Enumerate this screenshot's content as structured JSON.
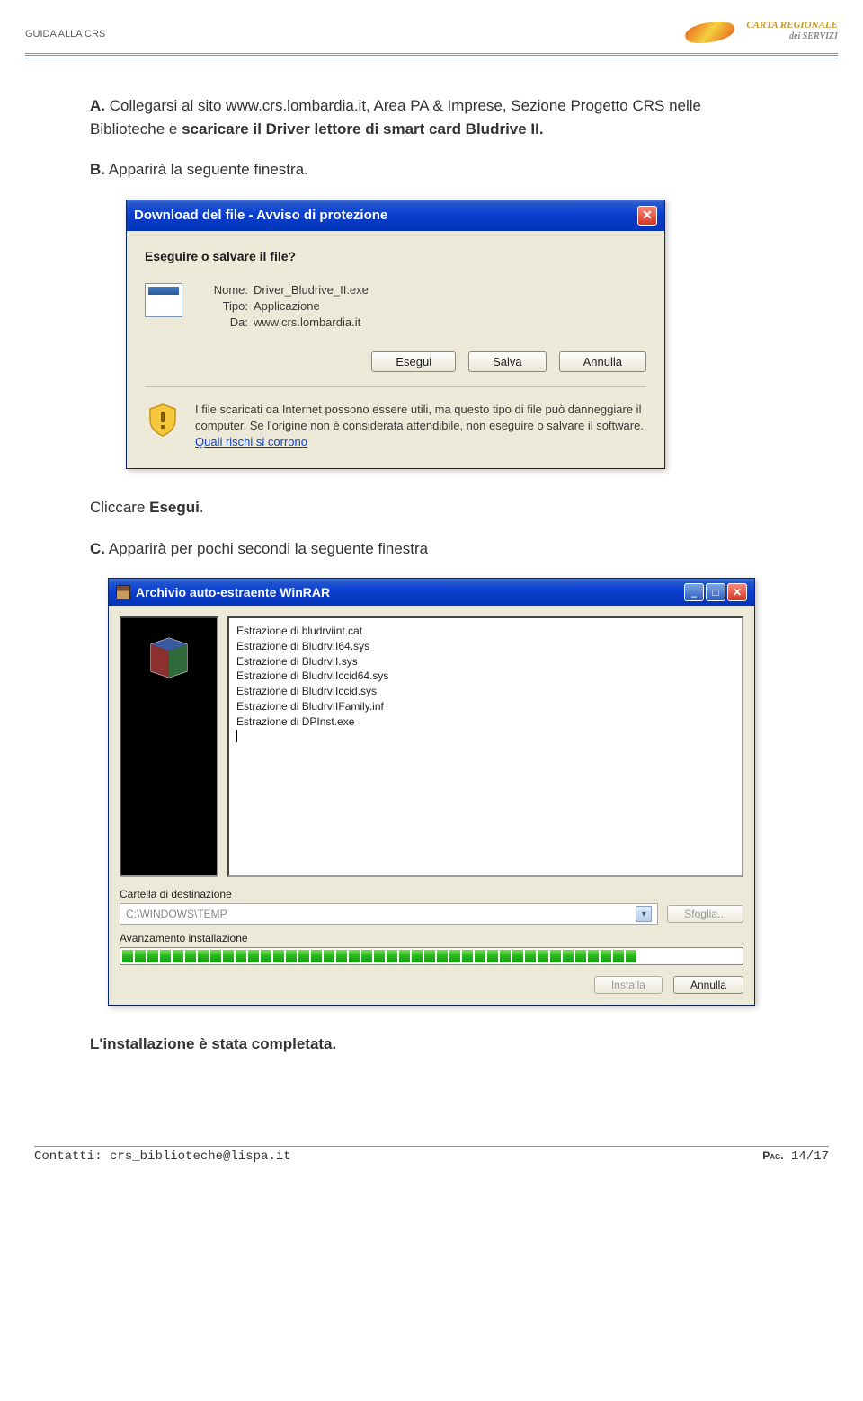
{
  "header": {
    "title": "GUIDA ALLA CRS",
    "logo_line1": "CARTA REGIONALE",
    "logo_line2": "dei SERVIZI"
  },
  "section_a": {
    "label": "A.",
    "text_pre": " Collegarsi al sito ",
    "url": "www.crs.lombardia.it",
    "text_mid": ", Area PA & Imprese, Sezione Progetto CRS nelle Biblioteche e ",
    "bold2": "scaricare il Driver lettore di smart card Bludrive II."
  },
  "section_b": {
    "label": "B.",
    "text": " Apparirà la seguente finestra."
  },
  "download_dialog": {
    "title": "Download del file - Avviso di protezione",
    "question": "Eseguire o salvare il file?",
    "rows": {
      "name_label": "Nome:",
      "name_value": "Driver_Bludrive_II.exe",
      "type_label": "Tipo:",
      "type_value": "Applicazione",
      "from_label": "Da:",
      "from_value": "www.crs.lombardia.it"
    },
    "buttons": {
      "run": "Esegui",
      "save": "Salva",
      "cancel": "Annulla"
    },
    "warning": "I file scaricati da Internet possono essere utili, ma questo tipo di file può danneggiare il computer. Se l'origine non è considerata attendibile, non eseguire o salvare il software. ",
    "warning_link": "Quali rischi si corrono"
  },
  "after_download": {
    "label": "Cliccare ",
    "bold": "Esegui",
    "dot": "."
  },
  "section_c": {
    "label": "C.",
    "text": " Apparirà per pochi secondi la seguente finestra"
  },
  "winrar": {
    "title": "Archivio auto-estraente WinRAR",
    "lines": [
      "Estrazione di bludrviint.cat",
      "Estrazione di BludrvII64.sys",
      "Estrazione di BludrvII.sys",
      "Estrazione di BludrvIIccid64.sys",
      "Estrazione di BludrvIIccid.sys",
      "Estrazione di BludrvIIFamily.inf",
      "Estrazione di DPInst.exe"
    ],
    "dest_label": "Cartella di destinazione",
    "dest_value": "C:\\WINDOWS\\TEMP",
    "browse": "Sfoglia...",
    "progress_label": "Avanzamento installazione",
    "install": "Installa",
    "cancel": "Annulla"
  },
  "conclusion": "L'installazione è stata completata.",
  "footer": {
    "contact_label": "Contatti:",
    "contact_value": "crs_biblioteche@lispa.it",
    "page_label": "Pag.",
    "page_value": "14/17"
  }
}
